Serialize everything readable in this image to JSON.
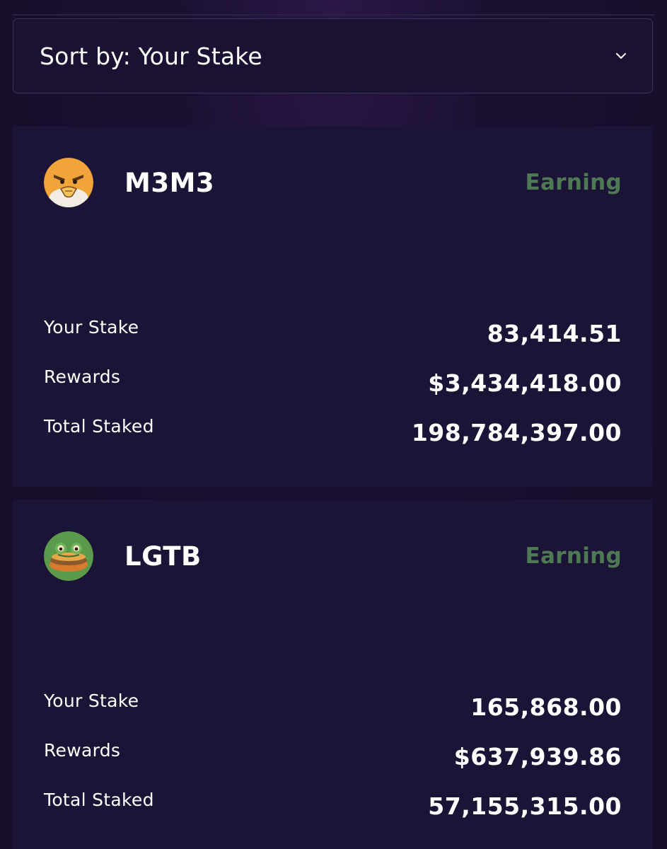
{
  "sort": {
    "label": "Sort by: Your Stake",
    "icon": "chevron-down-icon"
  },
  "colors": {
    "background": "#160e2a",
    "card": "#1c1436",
    "status_earning": "#4e7a53",
    "text": "#ffffff"
  },
  "pools": [
    {
      "name": "M3M3",
      "status": "Earning",
      "avatar_icon": "orange-bird-avatar",
      "rows": [
        {
          "label": "Your Stake",
          "value": "83,414.51"
        },
        {
          "label": "Rewards",
          "value": "$3,434,418.00"
        },
        {
          "label": "Total Staked",
          "value": "198,784,397.00"
        }
      ]
    },
    {
      "name": "LGTB",
      "status": "Earning",
      "avatar_icon": "green-frog-burger-avatar",
      "rows": [
        {
          "label": "Your Stake",
          "value": "165,868.00"
        },
        {
          "label": "Rewards",
          "value": "$637,939.86"
        },
        {
          "label": "Total Staked",
          "value": "57,155,315.00"
        }
      ]
    }
  ]
}
